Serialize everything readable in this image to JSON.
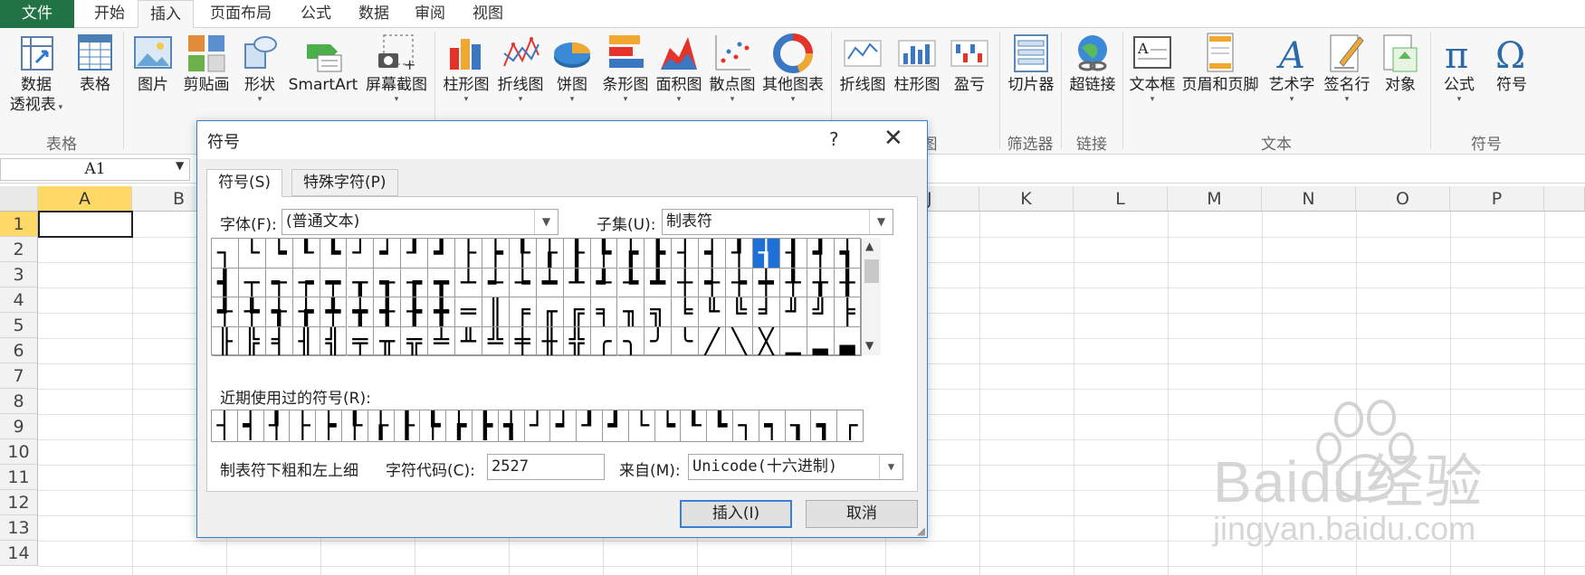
{
  "menu": {
    "tabs": [
      "文件",
      "开始",
      "插入",
      "页面布局",
      "公式",
      "数据",
      "审阅",
      "视图"
    ],
    "active": "插入"
  },
  "ribbon": {
    "buttons": [
      {
        "label": "数据",
        "label2": "透视表",
        "icon": "pivot-table-icon"
      },
      {
        "label": "表格",
        "icon": "table-icon"
      },
      {
        "label": "图片",
        "icon": "picture-icon"
      },
      {
        "label": "剪贴画",
        "icon": "clip-art-icon"
      },
      {
        "label": "形状",
        "icon": "shapes-icon"
      },
      {
        "label": "SmartArt",
        "icon": "smartart-icon"
      },
      {
        "label": "屏幕截图",
        "icon": "screenshot-icon"
      },
      {
        "label": "柱形图",
        "icon": "column-chart-icon"
      },
      {
        "label": "折线图",
        "icon": "line-chart-icon"
      },
      {
        "label": "饼图",
        "icon": "pie-chart-icon"
      },
      {
        "label": "条形图",
        "icon": "bar-chart-icon"
      },
      {
        "label": "面积图",
        "icon": "area-chart-icon"
      },
      {
        "label": "散点图",
        "icon": "scatter-chart-icon"
      },
      {
        "label": "其他图表",
        "icon": "other-charts-icon"
      },
      {
        "label": "折线图",
        "icon": "sparkline-line-icon"
      },
      {
        "label": "柱形图",
        "icon": "sparkline-column-icon"
      },
      {
        "label": "盈亏",
        "icon": "sparkline-winloss-icon"
      },
      {
        "label": "切片器",
        "icon": "slicer-icon"
      },
      {
        "label": "超链接",
        "icon": "hyperlink-icon"
      },
      {
        "label": "文本框",
        "icon": "textbox-icon"
      },
      {
        "label": "页眉和页脚",
        "icon": "header-footer-icon"
      },
      {
        "label": "艺术字",
        "icon": "wordart-icon"
      },
      {
        "label": "签名行",
        "icon": "signature-line-icon"
      },
      {
        "label": "对象",
        "icon": "object-icon"
      },
      {
        "label": "公式",
        "icon": "equation-icon"
      },
      {
        "label": "符号",
        "icon": "symbol-icon"
      }
    ],
    "groups": {
      "tables": "表格",
      "charts_tail": "图",
      "filter": "筛选器",
      "links": "链接",
      "text": "文本",
      "symbols": "符号"
    }
  },
  "formula_bar": {
    "name_box": "A1"
  },
  "sheet": {
    "columns": [
      "A",
      "B",
      "",
      "",
      "",
      "",
      "",
      "",
      "",
      "J",
      "K",
      "L",
      "M",
      "N",
      "O",
      "P"
    ],
    "rows": [
      "1",
      "2",
      "3",
      "4",
      "5",
      "6",
      "7",
      "8",
      "9",
      "10",
      "11",
      "12",
      "13",
      "14"
    ]
  },
  "dialog": {
    "title": "符号",
    "help": "?",
    "close": "✕",
    "tabs": [
      "符号(S)",
      "特殊字符(P)"
    ],
    "font_label": "字体(F):",
    "font_value": "(普通文本)",
    "subset_label": "子集(U):",
    "subset_value": "制表符",
    "symbols": [
      [
        "┐",
        "└",
        "┕",
        "┖",
        "┗",
        "┘",
        "┙",
        "┚",
        "┛",
        "├",
        "┝",
        "┞",
        "┟",
        "┠",
        "┡",
        "┢",
        "┣",
        "┤",
        "┥",
        "┦",
        "┧",
        "┨",
        "┩",
        "┪"
      ],
      [
        "┫",
        "┬",
        "┭",
        "┮",
        "┯",
        "┰",
        "┱",
        "┲",
        "┳",
        "┴",
        "┵",
        "┶",
        "┷",
        "┸",
        "┹",
        "┺",
        "┻",
        "┼",
        "┽",
        "┾",
        "┿",
        "╀",
        "╁",
        "╂"
      ],
      [
        "╃",
        "╄",
        "╅",
        "╆",
        "╇",
        "╈",
        "╉",
        "╊",
        "╋",
        "═",
        "║",
        "╒",
        "╓",
        "╔",
        "╕",
        "╖",
        "╗",
        "╘",
        "╙",
        "╚",
        "╛",
        "╜",
        "╝",
        "╞"
      ],
      [
        "╟",
        "╠",
        "╡",
        "╢",
        "╣",
        "╤",
        "╥",
        "╦",
        "╧",
        "╨",
        "╩",
        "╪",
        "╫",
        "╬",
        "╭",
        "╮",
        "╯",
        "╰",
        "╱",
        "╲",
        "╳",
        "▁",
        "▂",
        "▃"
      ]
    ],
    "selected": "┧",
    "recent_label": "近期使用过的符号(R):",
    "recent": [
      "┤",
      "┥",
      "┦",
      "├",
      "┝",
      "┞",
      "┟",
      "┠",
      "┡",
      "┢",
      "┣",
      "┪",
      "┘",
      "┙",
      "┚",
      "┛",
      "└",
      "┕",
      "┖",
      "┗",
      "┐",
      "┑",
      "┒",
      "┓",
      "┌"
    ],
    "char_name": "制表符下粗和左上细",
    "code_label": "字符代码(C):",
    "code_value": "2527",
    "from_label": "来自(M):",
    "from_value": "Unicode(十六进制)",
    "insert": "插入(I)",
    "cancel": "取消"
  },
  "watermark": {
    "brand": "Baidu经验",
    "url": "jingyan.baidu.com"
  },
  "colors": {
    "excel_green": "#217346",
    "accent_blue": "#1e6fd6",
    "cell_select": "#217346"
  }
}
